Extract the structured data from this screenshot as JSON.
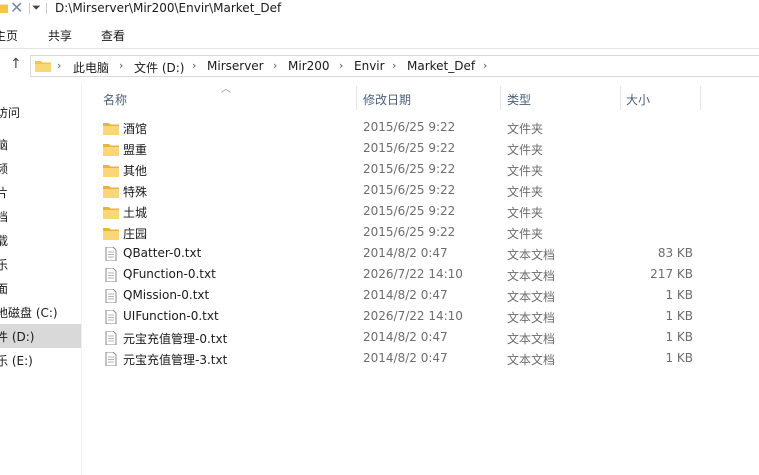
{
  "window": {
    "title_path": "D:\\Mirserver\\Mir200\\Envir\\Market_Def"
  },
  "ribbon": {
    "tabs": [
      {
        "label": "主页"
      },
      {
        "label": "共享"
      },
      {
        "label": "查看"
      }
    ]
  },
  "address_bar": {
    "crumbs": [
      "此电脑",
      "文件 (D:)",
      "Mirserver",
      "Mir200",
      "Envir",
      "Market_Def"
    ]
  },
  "nav_pane": {
    "items": [
      {
        "label": "访问",
        "selected": false
      },
      {
        "label": "脑",
        "selected": false
      },
      {
        "label": "频",
        "selected": false
      },
      {
        "label": "片",
        "selected": false
      },
      {
        "label": "档",
        "selected": false
      },
      {
        "label": "载",
        "selected": false
      },
      {
        "label": "乐",
        "selected": false
      },
      {
        "label": "面",
        "selected": false
      },
      {
        "label": "地磁盘 (C:)",
        "selected": false
      },
      {
        "label": "件 (D:)",
        "selected": true
      },
      {
        "label": "乐 (E:)",
        "selected": false
      }
    ]
  },
  "columns": {
    "name": "名称",
    "date": "修改日期",
    "type": "类型",
    "size": "大小"
  },
  "files": [
    {
      "name": "酒馆",
      "date": "2015/6/25 9:22",
      "type": "文件夹",
      "size": "",
      "icon": "folder-icon"
    },
    {
      "name": "盟重",
      "date": "2015/6/25 9:22",
      "type": "文件夹",
      "size": "",
      "icon": "folder-icon"
    },
    {
      "name": "其他",
      "date": "2015/6/25 9:22",
      "type": "文件夹",
      "size": "",
      "icon": "folder-icon"
    },
    {
      "name": "特殊",
      "date": "2015/6/25 9:22",
      "type": "文件夹",
      "size": "",
      "icon": "folder-icon"
    },
    {
      "name": "土城",
      "date": "2015/6/25 9:22",
      "type": "文件夹",
      "size": "",
      "icon": "folder-icon"
    },
    {
      "name": "庄园",
      "date": "2015/6/25 9:22",
      "type": "文件夹",
      "size": "",
      "icon": "folder-icon"
    },
    {
      "name": "QBatter-0.txt",
      "date": "2014/8/2 0:47",
      "type": "文本文档",
      "size": "83 KB",
      "icon": "text-file-icon"
    },
    {
      "name": "QFunction-0.txt",
      "date": "2026/7/22 14:10",
      "type": "文本文档",
      "size": "217 KB",
      "icon": "text-file-icon"
    },
    {
      "name": "QMission-0.txt",
      "date": "2014/8/2 0:47",
      "type": "文本文档",
      "size": "1 KB",
      "icon": "text-file-icon"
    },
    {
      "name": "UIFunction-0.txt",
      "date": "2026/7/22 14:10",
      "type": "文本文档",
      "size": "1 KB",
      "icon": "text-file-icon"
    },
    {
      "name": "元宝充值管理-0.txt",
      "date": "2014/8/2 0:47",
      "type": "文本文档",
      "size": "1 KB",
      "icon": "text-file-icon"
    },
    {
      "name": "元宝充值管理-3.txt",
      "date": "2014/8/2 0:47",
      "type": "文本文档",
      "size": "1 KB",
      "icon": "text-file-icon"
    }
  ],
  "colors": {
    "folder": "#f3c64a",
    "selected_nav": "#d9d9d9",
    "header_text": "#4c607a"
  }
}
